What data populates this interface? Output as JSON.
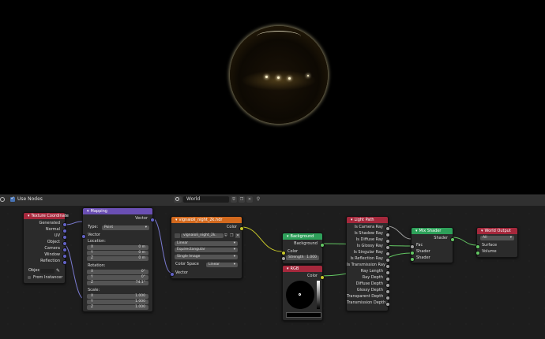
{
  "header": {
    "use_nodes_label": "Use Nodes",
    "world_name": "World"
  },
  "nodes": {
    "tex_coord": {
      "title": "Texture Coordinate",
      "outputs": [
        "Generated",
        "Normal",
        "UV",
        "Object",
        "Camera",
        "Window",
        "Reflection"
      ],
      "object_label": "Objec",
      "from_instancer": "From Instancer"
    },
    "mapping": {
      "title": "Mapping",
      "output": "Vector",
      "type_label": "Type:",
      "type_value": "Point",
      "vector_label": "Vector",
      "location_label": "Location:",
      "location": [
        {
          "axis": "X",
          "value": "0 m"
        },
        {
          "axis": "Y",
          "value": "0 m"
        },
        {
          "axis": "Z",
          "value": "0 m"
        }
      ],
      "rotation_label": "Rotation:",
      "rotation": [
        {
          "axis": "X",
          "value": "0°"
        },
        {
          "axis": "Y",
          "value": "0°"
        },
        {
          "axis": "Z",
          "value": "74.1°"
        }
      ],
      "scale_label": "Scale:",
      "scale": [
        {
          "axis": "X",
          "value": "1.000"
        },
        {
          "axis": "Y",
          "value": "1.000"
        },
        {
          "axis": "Z",
          "value": "1.000"
        }
      ]
    },
    "env_tex": {
      "title": "vignaioli_night_2k.hdr",
      "output": "Color",
      "image_name": "vignaioli_night_2k.",
      "interpolation": "Linear",
      "projection": "Equirectangular",
      "source": "Single Image",
      "color_space_label": "Color Space",
      "color_space": "Linear",
      "vector_label": "Vector"
    },
    "background": {
      "title": "Background",
      "output": "Background",
      "color_label": "Color",
      "strength_label": "Strength",
      "strength_value": "1.000"
    },
    "rgb": {
      "title": "RGB",
      "output": "Color"
    },
    "light_path": {
      "title": "Light Path",
      "outputs": [
        "Is Camera Ray",
        "Is Shadow Ray",
        "Is Diffuse Ray",
        "Is Glossy Ray",
        "Is Singular Ray",
        "Is Reflection Ray",
        "Is Transmission Ray",
        "Ray Length",
        "Ray Depth",
        "Diffuse Depth",
        "Glossy Depth",
        "Transparent Depth",
        "Transmission Depth"
      ]
    },
    "mix_shader": {
      "title": "Mix Shader",
      "output": "Shader",
      "inputs": [
        "Fac",
        "Shader",
        "Shader"
      ]
    },
    "world_output": {
      "title": "World Output",
      "target": "All",
      "inputs": [
        "Surface",
        "Volume"
      ]
    }
  },
  "colors": {
    "input_header": "#a5283c",
    "vector_header": "#6a4fb3",
    "texture_header": "#d2691e",
    "shader_header": "#2ea05a",
    "output_header": "#a5283c",
    "socket_vector": "#6363c7",
    "socket_color": "#c7c729",
    "socket_shader": "#63c763",
    "socket_float": "#a1a1a1"
  }
}
